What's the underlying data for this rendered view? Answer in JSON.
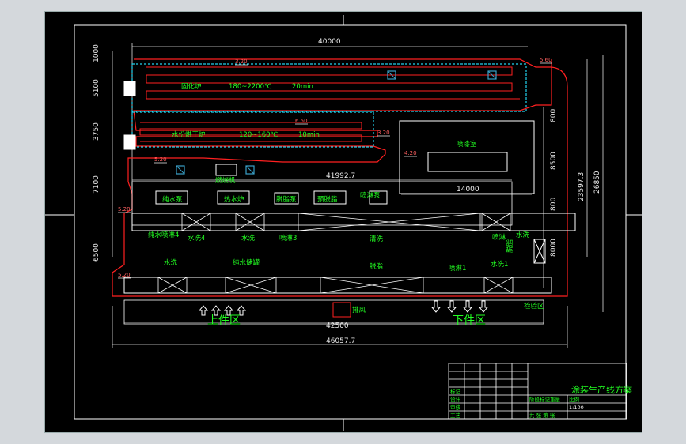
{
  "drawing": {
    "title": "涂装生产线方案",
    "scale": "1:100",
    "colors": {
      "background": "#000000",
      "frame": "#ffffff",
      "dimension": "#e8e8e8",
      "conveyor": "#ff2020",
      "equipment": "#ffffff",
      "text": "#00ff00",
      "oven_outline": "#22d3ee",
      "filter_mark": "#3aa0c8",
      "slope_mark": "#ffffff"
    }
  },
  "dimensions": {
    "top_total": "40000",
    "left_1": "1000",
    "left_2": "5100",
    "left_3": "3750",
    "left_4": "7100",
    "left_5": "6500",
    "mid_length": "41992.7",
    "right_1": "800",
    "right_2": "8500",
    "right_3": "800",
    "right_4": "8000",
    "right_total": "23597.3",
    "far_right": "26850",
    "room_width": "14000",
    "bottom_1": "42500",
    "bottom_2": "46057.7"
  },
  "slope_marks": [
    "3.20",
    "5.60",
    "6.50",
    "3.20",
    "4.20",
    "5.20",
    "5.20",
    "5.20"
  ],
  "ovens": {
    "top_label": "固化炉",
    "top_temp": "180~2200℃",
    "top_time": "20min",
    "mid_label": "水份烘干炉",
    "mid_temp": "120~160℃",
    "mid_time": "10min"
  },
  "rooms": {
    "spray_room": "喷漆室",
    "burner": "燃烧机"
  },
  "upper_row_units": [
    "纯水泵",
    "热水炉",
    "脱脂泵",
    "预脱脂",
    "喷淋泵"
  ],
  "line_labels": {
    "spray4": "纯水喷淋4",
    "wash4": "水洗4",
    "spray3": "喷淋3",
    "cleaning": "清洗",
    "wash1_top": "水洗",
    "spray_top": "喷淋",
    "side_wash": "水洗",
    "degrease": "脱脂",
    "wash2": "水洗",
    "tank": "纯水储罐",
    "middle": "脱脂",
    "spray1": "喷淋1",
    "wash1": "水洗1",
    "exhaust": "排风"
  },
  "zones": {
    "loading": "上件区",
    "unloading": "下件区",
    "inspect": "检验区"
  },
  "title_block": {
    "rows": [
      "标记",
      "设计",
      "审核",
      "工艺"
    ],
    "stage": "阶段标记",
    "weight": "重量",
    "ratio": "比例",
    "sheet": "共 张 第 张"
  }
}
